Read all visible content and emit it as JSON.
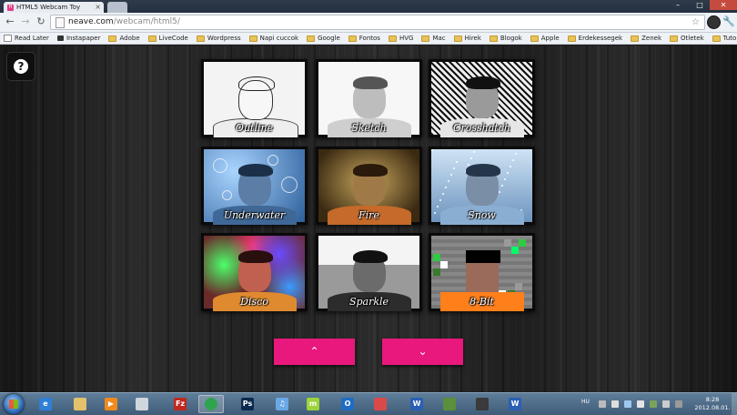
{
  "browser": {
    "tab_title": "HTML5 Webcam Toy",
    "tab_favicon_text": "H",
    "url_host": "neave.com",
    "url_path": "/webcam/html5/",
    "window_controls": {
      "minimize": "–",
      "maximize": "□",
      "close": "✕"
    }
  },
  "bookmarks": [
    {
      "label": "Read Later",
      "icon": "page"
    },
    {
      "label": "Instapaper",
      "icon": "instapaper"
    },
    {
      "label": "Adobe",
      "icon": "folder"
    },
    {
      "label": "LiveCode",
      "icon": "folder"
    },
    {
      "label": "Wordpress",
      "icon": "folder"
    },
    {
      "label": "Napi cuccok",
      "icon": "folder"
    },
    {
      "label": "Google",
      "icon": "folder"
    },
    {
      "label": "Fontos",
      "icon": "folder"
    },
    {
      "label": "HVG",
      "icon": "folder"
    },
    {
      "label": "Mac",
      "icon": "folder"
    },
    {
      "label": "Hirek",
      "icon": "folder"
    },
    {
      "label": "Blogok",
      "icon": "folder"
    },
    {
      "label": "Apple",
      "icon": "folder"
    },
    {
      "label": "Erdekessegek",
      "icon": "folder"
    },
    {
      "label": "Zenek",
      "icon": "folder"
    },
    {
      "label": "Otletek",
      "icon": "folder"
    },
    {
      "label": "Tutorials",
      "icon": "folder"
    }
  ],
  "help_button": "?",
  "effects": [
    {
      "label": "Outline",
      "style": "outline"
    },
    {
      "label": "Sketch",
      "style": "sketch"
    },
    {
      "label": "Crosshatch",
      "style": "crosshatch"
    },
    {
      "label": "Underwater",
      "style": "underwater"
    },
    {
      "label": "Fire",
      "style": "fire"
    },
    {
      "label": "Snow",
      "style": "snow"
    },
    {
      "label": "Disco",
      "style": "disco"
    },
    {
      "label": "Sparkle",
      "style": "sparkle"
    },
    {
      "label": "8-Bit",
      "style": "8bit"
    }
  ],
  "pager": {
    "up_label": "⌃",
    "down_label": "⌄",
    "color": "#e8187c"
  },
  "taskbar": {
    "apps": [
      {
        "name": "explorer-ie",
        "text": "e",
        "color": "#2f7fd6"
      },
      {
        "name": "file-explorer",
        "text": "",
        "color": "#e3c26b"
      },
      {
        "name": "media-player",
        "text": "▶",
        "color": "#f08a1c"
      },
      {
        "name": "notepad",
        "text": "",
        "color": "#cfd6de"
      },
      {
        "name": "filezilla",
        "text": "Fz",
        "color": "#c0281e"
      },
      {
        "name": "chrome",
        "text": "",
        "color": "#2fa44f",
        "active": true
      },
      {
        "name": "photoshop",
        "text": "Ps",
        "color": "#0b2a4f"
      },
      {
        "name": "itunes",
        "text": "♫",
        "color": "#6aa7e6"
      },
      {
        "name": "messenger",
        "text": "m",
        "color": "#9cd43a"
      },
      {
        "name": "outlook",
        "text": "O",
        "color": "#1f6dc2"
      },
      {
        "name": "snipping-tool",
        "text": "",
        "color": "#d84a4a"
      },
      {
        "name": "word",
        "text": "W",
        "color": "#2b5fb4"
      },
      {
        "name": "minecraft",
        "text": "",
        "color": "#5b8f3a"
      },
      {
        "name": "media-center",
        "text": "",
        "color": "#3a3a3a"
      },
      {
        "name": "word-doc",
        "text": "W",
        "color": "#2b5fb4"
      }
    ],
    "language": "HU",
    "time": "8:28",
    "date": "2012.08.01."
  }
}
